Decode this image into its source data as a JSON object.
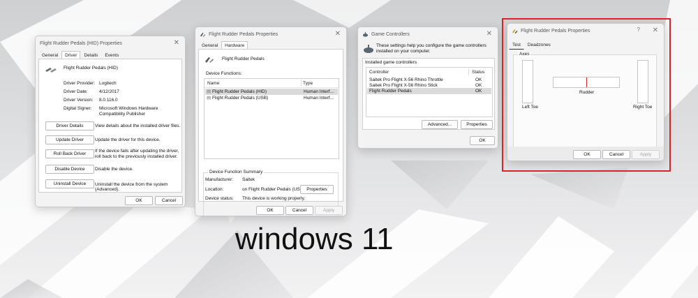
{
  "caption": "windows 11",
  "dialog_hid": {
    "title": "Flight Rudder Pedals (HID) Properties",
    "tabs": [
      "General",
      "Driver",
      "Details",
      "Events"
    ],
    "device_name": "Flight Rudder Pedals (HID)",
    "fields": [
      {
        "label": "Driver Provider:",
        "value": "Logitech"
      },
      {
        "label": "Driver Date:",
        "value": "4/12/2017"
      },
      {
        "label": "Driver Version:",
        "value": "8.0.116.0"
      },
      {
        "label": "Digital Signer:",
        "value": "Microsoft Windows Hardware Compatibility Publisher"
      }
    ],
    "actions": [
      {
        "button": "Driver Details",
        "desc": "View details about the installed driver files."
      },
      {
        "button": "Update Driver",
        "desc": "Update the driver for this device."
      },
      {
        "button": "Roll Back Driver",
        "desc": "If the device fails after updating the driver, roll back to the previously installed driver."
      },
      {
        "button": "Disable Device",
        "desc": "Disable the device."
      },
      {
        "button": "Uninstall Device",
        "desc": "Uninstall the device from the system (Advanced)."
      }
    ],
    "ok": "OK",
    "cancel": "Cancel"
  },
  "dialog_hw": {
    "title": "Flight Rudder Pedals Properties",
    "tabs": [
      "General",
      "Hardware"
    ],
    "device_name": "Flight Rudder Pedals",
    "functions_label": "Device Functions:",
    "columns": [
      "Name",
      "Type"
    ],
    "rows": [
      {
        "name": "Flight Rudder Pedals (HID)",
        "type": "Human Interf..."
      },
      {
        "name": "Flight Rudder Pedals (USB)",
        "type": "Human Interf..."
      }
    ],
    "summary_label": "Device Function Summary",
    "summary": [
      {
        "label": "Manufacturer:",
        "value": "Saitek"
      },
      {
        "label": "Location:",
        "value": "on Flight Rudder Pedals (USB)"
      },
      {
        "label": "Device status:",
        "value": "This device is working properly."
      }
    ],
    "properties": "Properties",
    "ok": "OK",
    "cancel": "Cancel",
    "apply": "Apply"
  },
  "dialog_gc": {
    "title": "Game Controllers",
    "intro": "These settings help you configure the game controllers installed on your computer.",
    "installed_label": "Installed game controllers",
    "columns": [
      "Controller",
      "Status"
    ],
    "rows": [
      {
        "name": "Saitek Pro Flight X-56 Rhino Throttle",
        "status": "OK"
      },
      {
        "name": "Saitek Pro Flight X-56 Rhino Stick",
        "status": "OK"
      },
      {
        "name": "Flight Rudder Pedals",
        "status": "OK"
      }
    ],
    "advanced": "Advanced...",
    "properties": "Properties",
    "ok": "OK"
  },
  "dialog_test": {
    "title": "Flight Rudder Pedals Properties",
    "help": "?",
    "tabs": [
      "Test",
      "Deadzones"
    ],
    "axes_label": "Axes",
    "left_toe": "Left Toe",
    "rudder": "Rudder",
    "right_toe": "Right Toe",
    "ok": "OK",
    "cancel": "Cancel",
    "apply": "Apply"
  },
  "colors": {
    "highlight": "#d8232a",
    "rudder_indicator": "#e02020"
  }
}
